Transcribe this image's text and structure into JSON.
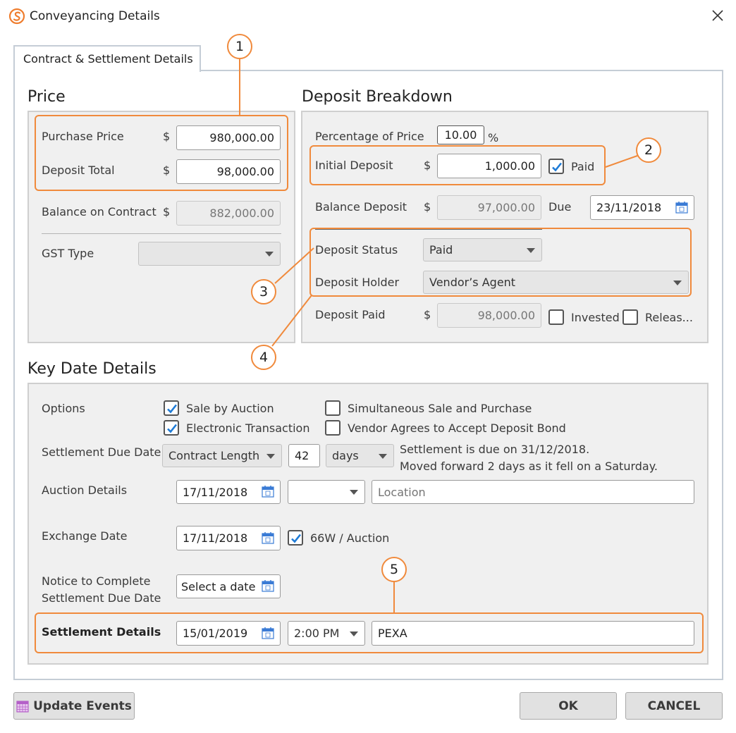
{
  "window": {
    "title": "Conveyancing Details"
  },
  "tabs": [
    {
      "label": "Contract & Settlement Details"
    }
  ],
  "price": {
    "heading": "Price",
    "purchase_price_label": "Purchase Price",
    "purchase_price_currency": "$",
    "purchase_price_value": "980,000.00",
    "deposit_total_label": "Deposit Total",
    "deposit_total_currency": "$",
    "deposit_total_value": "98,000.00",
    "balance_label": "Balance on Contract",
    "balance_currency": "$",
    "balance_value": "882,000.00",
    "gst_label": "GST Type",
    "gst_value": ""
  },
  "deposit": {
    "heading": "Deposit Breakdown",
    "percentage_label": "Percentage of Price",
    "percentage_value": "10.00",
    "percentage_unit": "%",
    "initial_label": "Initial Deposit",
    "initial_currency": "$",
    "initial_value": "1,000.00",
    "paid_label": "Paid",
    "paid_checked": true,
    "balance_label": "Balance Deposit",
    "balance_currency": "$",
    "balance_value": "97,000.00",
    "due_label": "Due",
    "due_value": "23/11/2018",
    "status_label": "Deposit Status",
    "status_value": "Paid",
    "holder_label": "Deposit Holder",
    "holder_value": "Vendor’s Agent",
    "deposit_paid_label": "Deposit Paid",
    "deposit_paid_currency": "$",
    "deposit_paid_value": "98,000.00",
    "invested_label": "Invested",
    "released_label": "Releas..."
  },
  "key_dates": {
    "heading": "Key Date Details",
    "options_label": "Options",
    "options": [
      {
        "label": "Sale by Auction",
        "checked": true
      },
      {
        "label": "Electronic Transaction",
        "checked": true
      },
      {
        "label": "Simultaneous Sale and Purchase",
        "checked": false
      },
      {
        "label": "Vendor Agrees to Accept Deposit Bond",
        "checked": false
      }
    ],
    "settlement_due_label": "Settlement Due Date",
    "settlement_due_type": "Contract Length",
    "settlement_due_number": "42",
    "settlement_due_unit": "days",
    "settlement_note_line1": "Settlement is due on 31/12/2018.",
    "settlement_note_line2": "Moved forward 2 days as it fell on a Saturday.",
    "auction_label": "Auction Details",
    "auction_date": "17/11/2018",
    "auction_time": "",
    "auction_location_placeholder": "Location",
    "exchange_label": "Exchange Date",
    "exchange_date": "17/11/2018",
    "exchange_option_label": "66W / Auction",
    "notice_label_line1": "Notice to Complete",
    "notice_label_line2": "Settlement Due Date",
    "notice_date": "Select a date",
    "settlement_details_label": "Settlement Details",
    "settlement_date": "15/01/2019",
    "settlement_time": "2:00 PM",
    "settlement_method": "PEXA"
  },
  "callouts": [
    "1",
    "2",
    "3",
    "4",
    "5"
  ],
  "buttons": {
    "update_events": "Update Events",
    "ok": "OK",
    "cancel": "CANCEL"
  },
  "colors": {
    "accent": "#f08a3c",
    "check": "#1e7bd6",
    "panel": "#f0f0f0"
  }
}
